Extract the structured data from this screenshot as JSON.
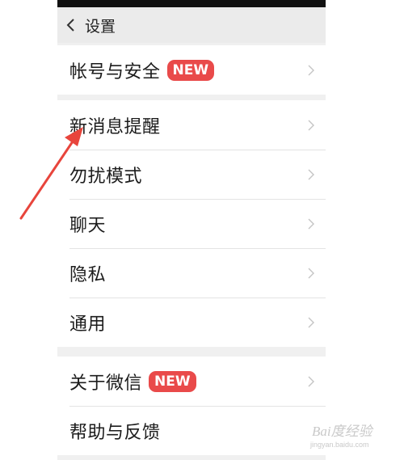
{
  "nav": {
    "title": "设置",
    "back_icon": "back-chevron-icon"
  },
  "groups": [
    {
      "items": [
        {
          "label": "帐号与安全",
          "badge": "NEW"
        }
      ]
    },
    {
      "items": [
        {
          "label": "新消息提醒"
        },
        {
          "label": "勿扰模式"
        },
        {
          "label": "聊天"
        },
        {
          "label": "隐私"
        },
        {
          "label": "通用"
        }
      ]
    },
    {
      "items": [
        {
          "label": "关于微信",
          "badge": "NEW"
        },
        {
          "label": "帮助与反馈"
        }
      ]
    }
  ],
  "watermark": {
    "main": "Bai度经验",
    "sub": "jingyan.baidu.com"
  },
  "colors": {
    "badge": "#e94a4a",
    "annotation_arrow": "#e8453c",
    "nav_bg": "#ebebeb",
    "group_gap": "#f0f0f0"
  }
}
